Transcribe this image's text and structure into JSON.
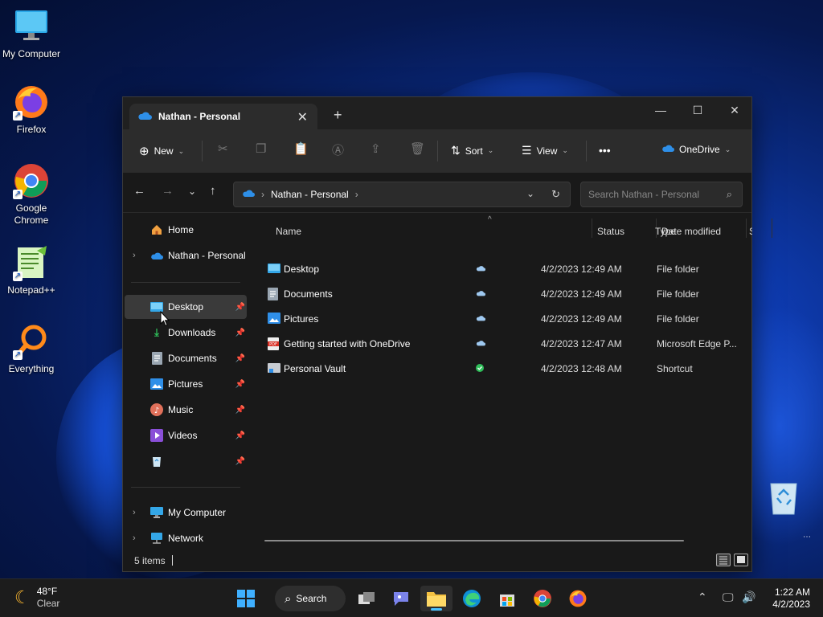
{
  "desktop": {
    "icons": [
      {
        "label": "My Computer"
      },
      {
        "label": "Firefox"
      },
      {
        "label": "Google Chrome"
      },
      {
        "label": "Notepad++"
      },
      {
        "label": "Everything"
      }
    ]
  },
  "window": {
    "tab_title": "Nathan - Personal",
    "toolbar": {
      "new_label": "New",
      "sort_label": "Sort",
      "view_label": "View",
      "more_label": "•••",
      "onedrive_label": "OneDrive"
    },
    "address": {
      "path": "Nathan - Personal",
      "search_placeholder": "Search Nathan - Personal"
    },
    "sidebar": {
      "home": "Home",
      "onedrive": "Nathan - Personal",
      "quick_access": [
        {
          "label": "Desktop"
        },
        {
          "label": "Downloads"
        },
        {
          "label": "Documents"
        },
        {
          "label": "Pictures"
        },
        {
          "label": "Music"
        },
        {
          "label": "Videos"
        },
        {
          "label": ""
        }
      ],
      "my_computer": "My Computer",
      "network": "Network"
    },
    "columns": {
      "name": "Name",
      "status": "Status",
      "date_modified": "Date modified",
      "type": "Type",
      "size": "S"
    },
    "files": [
      {
        "name": "Desktop",
        "status": "cloud",
        "date": "4/2/2023 12:49 AM",
        "type": "File folder"
      },
      {
        "name": "Documents",
        "status": "cloud",
        "date": "4/2/2023 12:49 AM",
        "type": "File folder"
      },
      {
        "name": "Pictures",
        "status": "cloud",
        "date": "4/2/2023 12:49 AM",
        "type": "File folder"
      },
      {
        "name": "Getting started with OneDrive",
        "status": "cloud",
        "date": "4/2/2023 12:47 AM",
        "type": "Microsoft Edge P..."
      },
      {
        "name": "Personal Vault",
        "status": "synced",
        "date": "4/2/2023 12:48 AM",
        "type": "Shortcut"
      }
    ],
    "status_bar": {
      "item_count": "5 items"
    }
  },
  "taskbar": {
    "weather_temp": "48°F",
    "weather_desc": "Clear",
    "search_label": "Search",
    "time": "1:22 AM",
    "date": "4/2/2023"
  },
  "colors": {
    "accent": "#4cc2ff",
    "onedrive_blue": "#2e8fe8",
    "synced_green": "#2fbf5a"
  }
}
